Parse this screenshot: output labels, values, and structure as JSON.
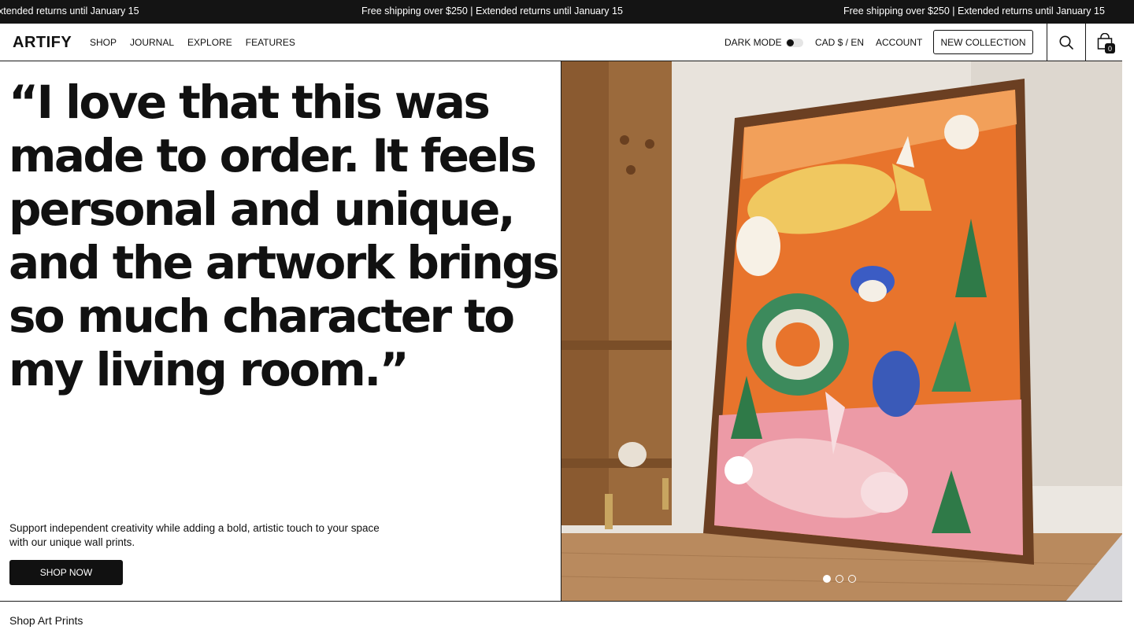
{
  "announcement": {
    "left_text": "xtended returns until January 15",
    "center_text": "Free shipping over $250 | Extended returns until January 15",
    "right_text": "Free shipping over $250 | Extended returns until January 15"
  },
  "header": {
    "logo": "ARTIFY",
    "nav": [
      {
        "label": "SHOP"
      },
      {
        "label": "JOURNAL"
      },
      {
        "label": "EXPLORE"
      },
      {
        "label": "FEATURES"
      }
    ],
    "dark_mode_label": "DARK MODE",
    "dark_mode_on": false,
    "currency": "CAD $ / EN",
    "account": "ACCOUNT",
    "new_collection": "NEW COLLECTION",
    "cart_count": "0"
  },
  "hero": {
    "quote": "“I love that this was made to order. It feels personal and unique, and the artwork brings so much character to my living room.”",
    "support_text": "Support independent creativity while adding a bold, artistic touch to your space with our unique wall prints.",
    "cta": "SHOP NOW",
    "slide_count": 3,
    "active_slide": 1
  },
  "section": {
    "title": "Shop Art Prints"
  },
  "colors": {
    "announcement_bg": "#141414",
    "text": "#111111",
    "artwork_orange": "#e8742c",
    "artwork_pink": "#ec9aa6"
  }
}
